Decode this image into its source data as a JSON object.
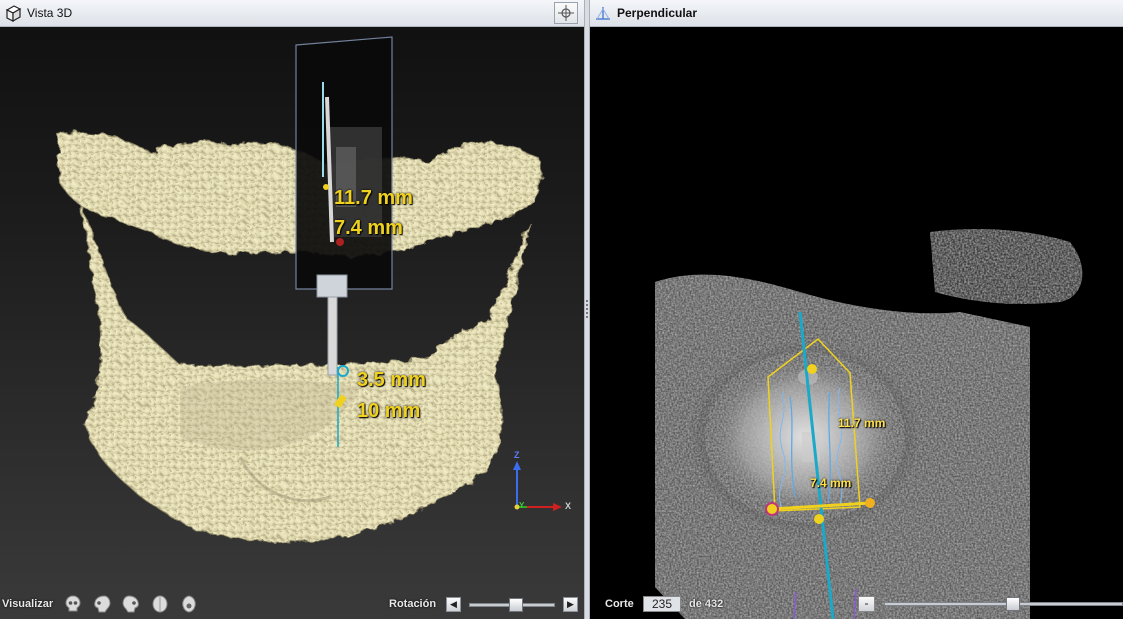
{
  "left_panel": {
    "title": "Vista 3D",
    "icons": {
      "title": "cube-icon",
      "center": "crosshair-icon"
    },
    "measurements": [
      "11.7 mm",
      "7.4 mm",
      "3.5 mm",
      "10 mm"
    ],
    "axes": {
      "z": "Z",
      "y": "Y",
      "x": "X"
    },
    "bottom": {
      "visualize_label": "Visualizar",
      "view_buttons": [
        "skull-front-icon",
        "skull-left-icon",
        "skull-right-icon",
        "skull-top-icon",
        "skull-bottom-icon"
      ],
      "rotation_label": "Rotación",
      "rotation_position": 0.55
    }
  },
  "right_panel": {
    "title": "Perpendicular",
    "icons": {
      "title": "perpendicular-icon"
    },
    "measurements": [
      "11.7 mm",
      "7.4 mm"
    ],
    "bottom": {
      "slice_label": "Corte",
      "slice_value": "235",
      "slice_of": "de 432",
      "minus_label": "-",
      "slice_fraction": 0.54
    }
  },
  "colors": {
    "bone": "#ece6be",
    "measure": "#f0d21e",
    "implant_axis": "#1aa9c9",
    "titlebar": "#e6e9ee"
  }
}
